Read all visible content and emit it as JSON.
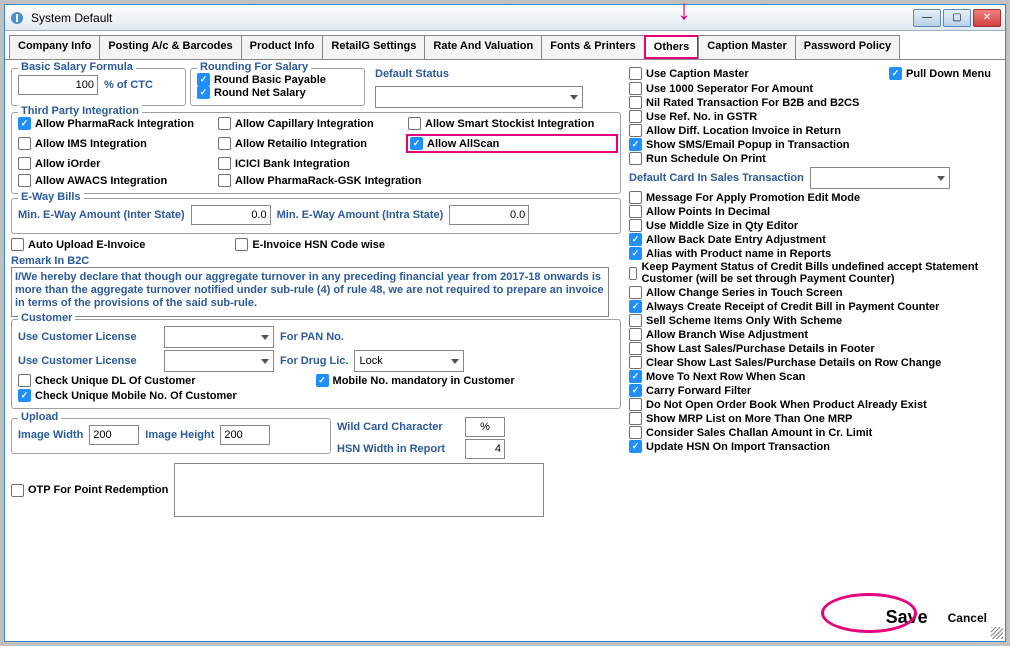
{
  "title": "System Default",
  "tabs": [
    "Company Info",
    "Posting A/c & Barcodes",
    "Product Info",
    "RetailG Settings",
    "Rate And Valuation",
    "Fonts & Printers",
    "Others",
    "Caption Master",
    "Password Policy"
  ],
  "activeTab": 6,
  "salary": {
    "legend": "Basic Salary Formula",
    "value": "100",
    "unit": "% of CTC"
  },
  "rounding": {
    "legend": "Rounding For Salary",
    "basic": "Round Basic Payable",
    "net": "Round Net Salary"
  },
  "defstatus": "Default Status",
  "third": {
    "legend": "Third Party Integration",
    "a": "Allow PharmaRack Integration",
    "b": "Allow Capillary Integration",
    "c": "Allow Smart Stockist Integration",
    "d": "Allow IMS Integration",
    "e": "Allow Retailio Integration",
    "f": "Allow AllScan",
    "g": "Allow iOrder",
    "h": "ICICI Bank Integration",
    "i": "Allow AWACS Integration",
    "j": "Allow PharmaRack-GSK Integration"
  },
  "eway": {
    "legend": "E-Way Bills",
    "l1": "Min. E-Way Amount (Inter State)",
    "v1": "0.0",
    "l2": "Min. E-Way Amount (Intra State)",
    "v2": "0.0"
  },
  "einv": {
    "auto": "Auto Upload E-Invoice",
    "hsn": "E-Invoice HSN Code wise"
  },
  "remarkLbl": "Remark In B2C",
  "remark": "I/We hereby declare that though our aggregate turnover in any preceding financial year from 2017-18 onwards is more than the aggregate turnover notified under sub-rule (4) of rule 48, we are not required to prepare an invoice in terms of the provisions of the said sub-rule.",
  "cust": {
    "legend": "Customer",
    "ucl": "Use Customer License",
    "pan": "For PAN No.",
    "drug": "For Drug Lic.",
    "drugval": "Lock",
    "dl": "Check Unique DL Of Customer",
    "mob": "Mobile No. mandatory in Customer",
    "mobunique": "Check Unique Mobile No. Of Customer"
  },
  "upload": {
    "legend": "Upload",
    "iw": "Image Width",
    "iwv": "200",
    "ih": "Image Height",
    "ihv": "200",
    "wc": "Wild Card Character",
    "wcv": "%",
    "hsn": "HSN Width in Report",
    "hsnv": "4"
  },
  "otp": "OTP For Point Redemption",
  "right": {
    "chk": [
      {
        "t": "Use Caption Master",
        "c": false
      },
      {
        "t": "Use 1000 Seperator For Amount",
        "c": false
      },
      {
        "t": "Nil Rated Transaction For B2B and B2CS",
        "c": false
      },
      {
        "t": "Use Ref. No. in GSTR",
        "c": false
      },
      {
        "t": "Allow Diff. Location Invoice in Return",
        "c": false
      },
      {
        "t": "Show SMS/Email Popup in Transaction",
        "c": true
      },
      {
        "t": "Run Schedule On Print",
        "c": false
      }
    ],
    "pulldown": "Pull Down Menu",
    "defcard": "Default Card In Sales Transaction",
    "chk2": [
      {
        "t": "Message For Apply Promotion Edit Mode",
        "c": false
      },
      {
        "t": "Allow Points In Decimal",
        "c": false
      },
      {
        "t": "Use Middle Size in Qty Editor",
        "c": false
      },
      {
        "t": "Allow Back Date Entry Adjustment",
        "c": true
      },
      {
        "t": "Alias with Product name in Reports",
        "c": true
      },
      {
        "t": "Keep Payment Status of Credit Bills undefined accept Statement Customer (will be set through Payment Counter)",
        "c": false
      },
      {
        "t": "Allow Change Series in Touch Screen",
        "c": false
      },
      {
        "t": "Always Create Receipt of Credit Bill in Payment Counter",
        "c": true
      },
      {
        "t": "Sell Scheme Items Only With Scheme",
        "c": false
      },
      {
        "t": "Allow Branch Wise Adjustment",
        "c": false
      },
      {
        "t": "Show Last Sales/Purchase Details in Footer",
        "c": false
      },
      {
        "t": "Clear Show Last Sales/Purchase Details on Row Change",
        "c": false
      },
      {
        "t": "Move To Next Row When Scan",
        "c": true
      },
      {
        "t": "Carry Forward Filter",
        "c": true
      },
      {
        "t": "Do Not Open Order Book When Product Already Exist",
        "c": false
      },
      {
        "t": "Show MRP List on More Than One MRP",
        "c": false
      },
      {
        "t": "Consider Sales Challan Amount in Cr. Limit",
        "c": false
      },
      {
        "t": "Update HSN On Import Transaction",
        "c": true
      }
    ]
  },
  "save": "Save",
  "cancel": "Cancel"
}
